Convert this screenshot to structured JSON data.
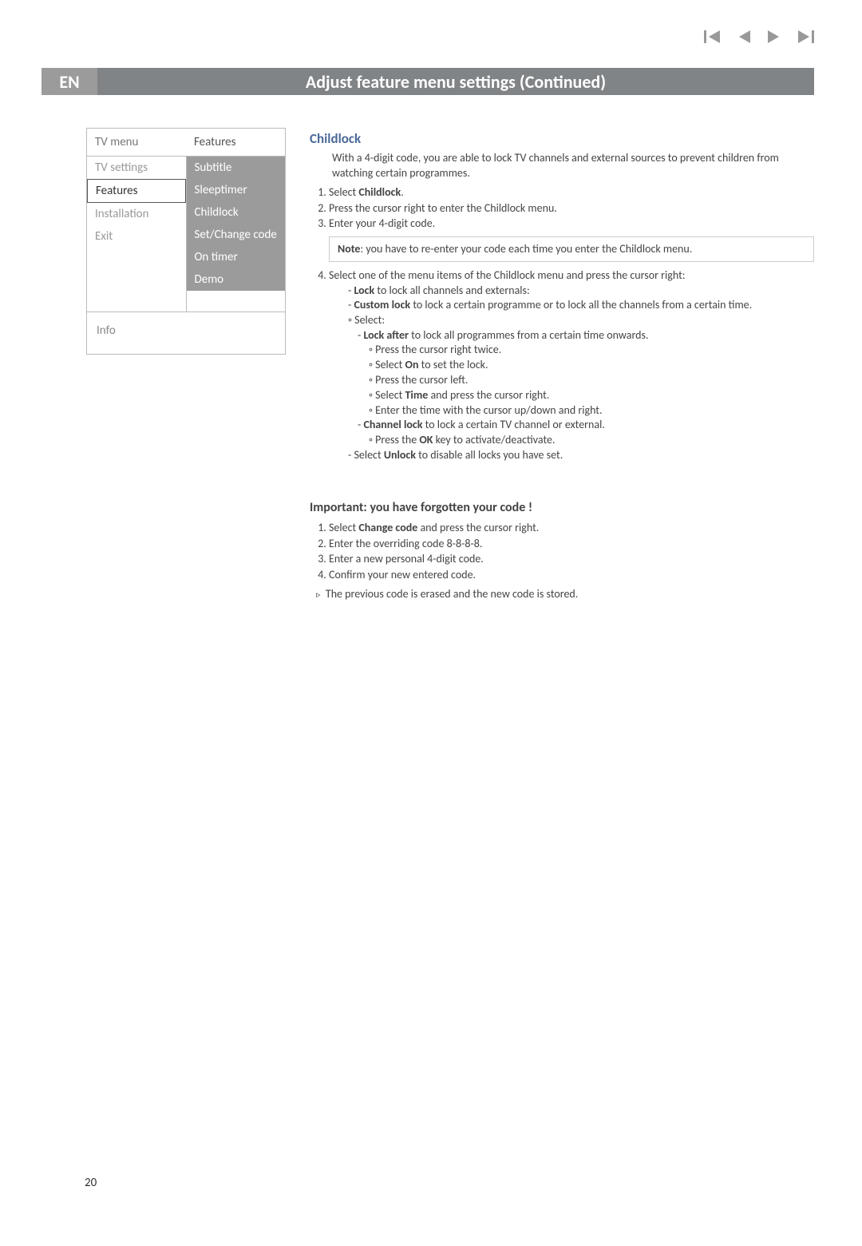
{
  "lang_badge": "EN",
  "title": "Adjust feature menu settings  (Continued)",
  "nav_icons": [
    "first-icon",
    "prev-icon",
    "next-icon",
    "last-icon"
  ],
  "menu": {
    "header_left": "TV menu",
    "header_right": "Features",
    "left_items": [
      "TV settings",
      "Features",
      "Installation",
      "Exit"
    ],
    "left_active_index": 1,
    "right_items": [
      "Subtitle",
      "Sleeptimer",
      "Childlock",
      "Set/Change code",
      "On timer",
      "Demo"
    ],
    "info_label": "Info"
  },
  "section": {
    "heading": "Childlock",
    "intro": "With a 4-digit code, you are able to lock TV channels and external sources to prevent children from watching certain programmes.",
    "steps123": [
      {
        "pre": "Select ",
        "bold": "Childlock",
        "post": "."
      },
      {
        "text": "Press the cursor right to enter the Childlock menu."
      },
      {
        "text": "Enter your 4-digit code."
      }
    ],
    "note_label": "Note",
    "note_text": ": you have to re-enter your code each time you enter the Childlock menu.",
    "step4_intro": "Select one of the menu items of the Childlock menu and press the cursor right:",
    "lock": {
      "label": "Lock",
      "text": " to lock all channels and externals:"
    },
    "custom_lock": {
      "label": "Custom lock",
      "text": " to lock a certain programme or to lock all the channels from a certain time."
    },
    "select_label": "Select:",
    "lock_after": {
      "label": "Lock after",
      "text": " to lock all programmes from a certain time onwards."
    },
    "la_sub": [
      "Press the cursor right twice.",
      {
        "pre": "Select ",
        "bold": "On",
        "post": " to set the lock."
      },
      "Press the cursor left.",
      {
        "pre": "Select ",
        "bold": "Time",
        "post": " and press the cursor right."
      },
      "Enter the time with the cursor up/down and right."
    ],
    "channel_lock": {
      "label": "Channel lock",
      "text": " to lock a certain TV channel or external."
    },
    "channel_sub": {
      "pre": "Press the ",
      "bold": "OK",
      "post": " key to activate/deactivate."
    },
    "unlock": {
      "pre": "- Select ",
      "bold": "Unlock",
      "post": " to disable all locks you have set."
    }
  },
  "important": {
    "heading": "Important: you have forgotten your code !",
    "steps": [
      {
        "pre": "Select ",
        "bold": "Change code",
        "post": " and press the cursor right."
      },
      {
        "text": "Enter the overriding code 8-8-8-8."
      },
      {
        "text": "Enter a new personal 4-digit code."
      },
      {
        "text": "Confirm your new entered code."
      }
    ],
    "result": "The previous code is erased and the new code is stored."
  },
  "page_number": "20"
}
